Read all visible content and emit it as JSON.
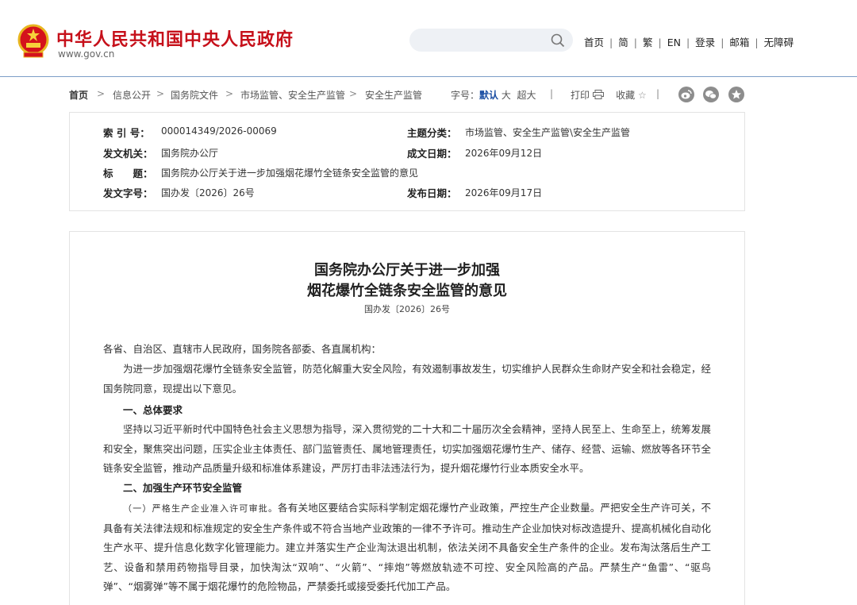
{
  "header": {
    "site_title": "中华人民共和国中央人民政府",
    "site_url": "www.gov.cn",
    "search_placeholder": "",
    "nav": [
      "首页",
      "简",
      "繁",
      "EN",
      "登录",
      "邮箱",
      "无障碍"
    ],
    "brand_color": "#c6101a"
  },
  "breadcrumb": {
    "items": [
      "首页",
      "信息公开",
      "国务院文件",
      "市场监管、安全生产监管",
      "安全生产监管"
    ],
    "font_label": "字号：",
    "font_options": [
      "默认",
      "大",
      "超大"
    ],
    "print": "打印",
    "favorite": "收藏"
  },
  "meta": {
    "index_label": "索 引 号：",
    "index_value": "000014349/2026-00069",
    "category_label": "主题分类：",
    "category_value": "市场监管、安全生产监管\\安全生产监管",
    "issuer_label": "发文机关：",
    "issuer_value": "国务院办公厅",
    "written_label": "成文日期：",
    "written_value": "2026年09月12日",
    "title_label": "标　　题：",
    "title_value": "国务院办公厅关于进一步加强烟花爆竹全链条安全监管的意见",
    "docno_label": "发文字号：",
    "docno_value": "国办发〔2026〕26号",
    "publish_label": "发布日期：",
    "publish_value": "2026年09月17日"
  },
  "article": {
    "title_line1": "国务院办公厅关于进一步加强",
    "title_line2": "烟花爆竹全链条安全监管的意见",
    "doc_no": "国办发〔2026〕26号",
    "greeting": "各省、自治区、直辖市人民政府，国务院各部委、各直属机构：",
    "intro": "为进一步加强烟花爆竹全链条安全监管，防范化解重大安全风险，有效遏制事故发生，切实维护人民群众生命财产安全和社会稳定，经国务院同意，现提出以下意见。",
    "section1": "一、总体要求",
    "section1_text": "坚持以习近平新时代中国特色社会主义思想为指导，深入贯彻党的二十大和二十届历次全会精神，坚持人民至上、生命至上，统筹发展和安全，聚焦突出问题，压实企业主体责任、部门监管责任、属地管理责任，切实加强烟花爆竹生产、储存、经营、运输、燃放等各环节全链条安全监管，推动产品质量升级和标准体系建设，严厉打击非法违法行为，提升烟花爆竹行业本质安全水平。",
    "section2": "二、加强生产环节安全监管",
    "item1_lead": "（一）严格生产企业准入许可审批。",
    "item1_text": "各有关地区要结合实际科学制定烟花爆竹产业政策，严控生产企业数量。严把安全生产许可关，不具备有关法律法规和标准规定的安全生产条件或不符合当地产业政策的一律不予许可。推动生产企业加快对标改造提升、提高机械化自动化生产水平、提升信息化数字化管理能力。建立并落实生产企业淘汰退出机制，依法关闭不具备安全生产条件的企业。发布淘汰落后生产工艺、设备和禁用药物指导目录，加快淘汰“双响”、“火箭”、“摔炮”等燃放轨迹不可控、安全风险高的产品。严禁生产“鱼雷”、“驱鸟弹”、“烟雾弹”等不属于烟花爆竹的危险物品，严禁委托或接受委托代加工产品。"
  }
}
